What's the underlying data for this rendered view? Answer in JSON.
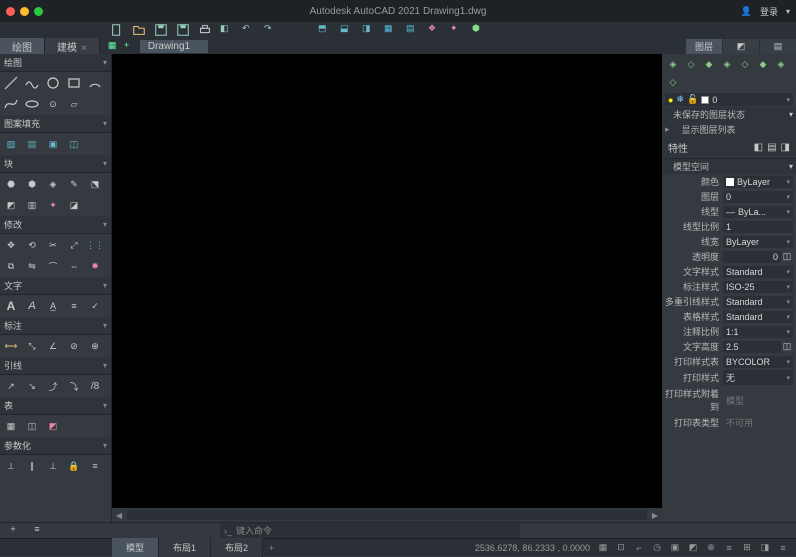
{
  "app": {
    "title": "Autodesk AutoCAD 2021   Drawing1.dwg",
    "login": "登录"
  },
  "left_tabs": {
    "draw": "绘图",
    "edit": "建模"
  },
  "file_tab": "Drawing1",
  "right_panel_tabs": {
    "layers": "图层"
  },
  "palette": {
    "draw": "绘图",
    "hatch": "图案填充",
    "block": "块",
    "modify": "修改",
    "text": "文字",
    "dim": "标注",
    "lead": "引线",
    "table": "表",
    "param": "参数化"
  },
  "layers": {
    "title": "图层",
    "layer0": "0",
    "unsaved": "未保存的图层状态",
    "showlist": "显示图层列表"
  },
  "props": {
    "title": "特性",
    "header": "模型空间",
    "color": {
      "label": "颜色",
      "value": "ByLayer"
    },
    "layer": {
      "label": "图层",
      "value": "0"
    },
    "ltype": {
      "label": "线型",
      "value": "ByLa..."
    },
    "ltscale": {
      "label": "线型比例",
      "value": "1"
    },
    "lweight": {
      "label": "线宽",
      "value": "ByLayer"
    },
    "transparency": {
      "label": "透明度",
      "value": "0"
    },
    "textstyle": {
      "label": "文字样式",
      "value": "Standard"
    },
    "dimstyle": {
      "label": "标注样式",
      "value": "ISO-25"
    },
    "mleadstyle": {
      "label": "多重引线样式",
      "value": "Standard"
    },
    "tablestyle": {
      "label": "表格样式",
      "value": "Standard"
    },
    "annoscale": {
      "label": "注释比例",
      "value": "1:1"
    },
    "textheight": {
      "label": "文字高度",
      "value": "2.5"
    },
    "plotstyle": {
      "label": "打印样式表",
      "value": "BYCOLOR"
    },
    "plotstyle2": {
      "label": "打印样式",
      "value": "无"
    },
    "plotattach": {
      "label": "打印样式附着到",
      "value": "模型"
    },
    "plottable": {
      "label": "打印表类型",
      "value": "不可用"
    }
  },
  "cmd": {
    "placeholder": "键入命令"
  },
  "status": {
    "model": "模型",
    "layout1": "布局1",
    "layout2": "布局2",
    "coords": "2536.6278, 86.2333 , 0.0000"
  }
}
